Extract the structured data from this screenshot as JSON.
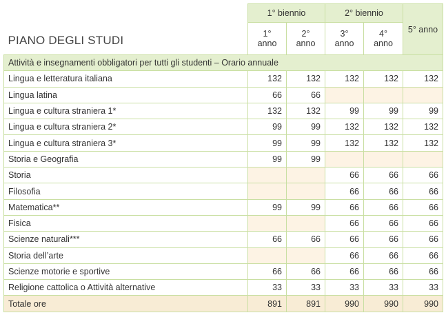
{
  "title": "PIANO DEGLI STUDI",
  "headers": {
    "group1": "1° biennio",
    "group2": "2° biennio",
    "fifth": "5° anno",
    "y1": [
      "1°",
      "anno"
    ],
    "y2": [
      "2°",
      "anno"
    ],
    "y3": [
      "3°",
      "anno"
    ],
    "y4": [
      "4°",
      "anno"
    ]
  },
  "section_label": "Attività e insegnamenti obbligatori per tutti gli studenti – Orario annuale",
  "rows": [
    {
      "subject": "Lingua e letteratura italiana",
      "values": [
        "132",
        "132",
        "132",
        "132",
        "132"
      ]
    },
    {
      "subject": "Lingua latina",
      "values": [
        "66",
        "66",
        "",
        "",
        ""
      ]
    },
    {
      "subject": "Lingua e cultura straniera 1*",
      "values": [
        "132",
        "132",
        "99",
        "99",
        "99"
      ]
    },
    {
      "subject": "Lingua e cultura straniera 2*",
      "values": [
        "99",
        "99",
        "132",
        "132",
        "132"
      ]
    },
    {
      "subject": "Lingua e cultura straniera 3*",
      "values": [
        "99",
        "99",
        "132",
        "132",
        "132"
      ]
    },
    {
      "subject": "Storia e Geografia",
      "values": [
        "99",
        "99",
        "",
        "",
        ""
      ]
    },
    {
      "subject": "Storia",
      "values": [
        "",
        "",
        "66",
        "66",
        "66"
      ]
    },
    {
      "subject": "Filosofia",
      "values": [
        "",
        "",
        "66",
        "66",
        "66"
      ]
    },
    {
      "subject": "Matematica**",
      "values": [
        "99",
        "99",
        "66",
        "66",
        "66"
      ]
    },
    {
      "subject": "Fisica",
      "values": [
        "",
        "",
        "66",
        "66",
        "66"
      ]
    },
    {
      "subject": "Scienze naturali***",
      "values": [
        "66",
        "66",
        "66",
        "66",
        "66"
      ]
    },
    {
      "subject": "Storia dell’arte",
      "values": [
        "",
        "",
        "66",
        "66",
        "66"
      ]
    },
    {
      "subject": "Scienze motorie e sportive",
      "values": [
        "66",
        "66",
        "66",
        "66",
        "66"
      ]
    },
    {
      "subject": "Religione cattolica o Attività alternative",
      "values": [
        "33",
        "33",
        "33",
        "33",
        "33"
      ]
    }
  ],
  "total": {
    "label": "Totale ore",
    "values": [
      "891",
      "891",
      "990",
      "990",
      "990"
    ]
  },
  "colors": {
    "header_green": "#e4efcf",
    "border_green": "#c9dfa2",
    "empty_cell": "#fdf3e4",
    "total_row": "#f8ecd5"
  }
}
